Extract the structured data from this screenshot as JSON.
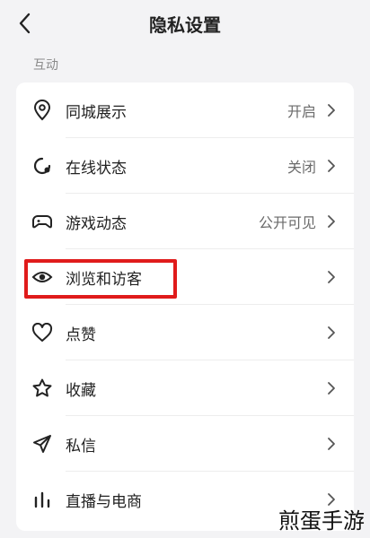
{
  "header": {
    "title": "隐私设置",
    "back_icon": "chevron-left-icon"
  },
  "section": {
    "title": "互动"
  },
  "rows": [
    {
      "icon": "location-pin-icon",
      "label": "同城展示",
      "value": "开启"
    },
    {
      "icon": "online-status-icon",
      "label": "在线状态",
      "value": "关闭"
    },
    {
      "icon": "gamepad-icon",
      "label": "游戏动态",
      "value": "公开可见"
    },
    {
      "icon": "eye-icon",
      "label": "浏览和访客",
      "value": ""
    },
    {
      "icon": "heart-icon",
      "label": "点赞",
      "value": ""
    },
    {
      "icon": "star-icon",
      "label": "收藏",
      "value": ""
    },
    {
      "icon": "paper-plane-icon",
      "label": "私信",
      "value": ""
    },
    {
      "icon": "bar-chart-icon",
      "label": "直播与电商",
      "value": ""
    }
  ],
  "watermark": {
    "text": "煎蛋手游"
  },
  "colors": {
    "highlight": "#e01b1b",
    "background": "#f3f3f5"
  }
}
